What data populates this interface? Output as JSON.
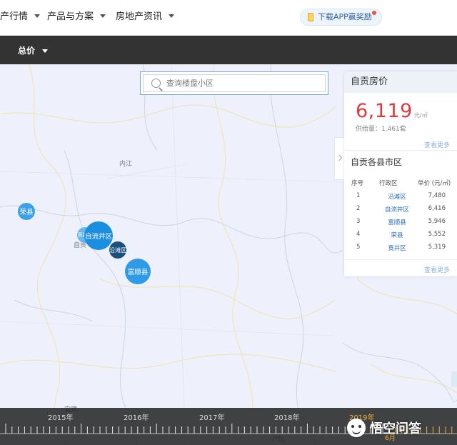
{
  "nav": {
    "items": [
      "产行情",
      "产品与方案",
      "房地产资讯"
    ],
    "app_button": "下载APP赢奖励"
  },
  "filter": {
    "total_price": "总价"
  },
  "search": {
    "placeholder": "查询楼盘小区"
  },
  "map": {
    "places": [
      "内江",
      "自贡",
      "泸州",
      "宜宾"
    ],
    "bubbles": [
      {
        "label": "荣县",
        "color": "#3aa0e8"
      },
      {
        "label": "自流井区",
        "color": "#1c8ee0"
      },
      {
        "label": "贡井区",
        "color": "#4fb0ee"
      },
      {
        "label": "沿滩区",
        "color": "#1a4f7e"
      },
      {
        "label": "富顺县",
        "color": "#2f9ae6"
      }
    ]
  },
  "panel": {
    "title": "自贡房价",
    "price": "6,119",
    "unit": "元/㎡",
    "supply": "供给量：1,461套",
    "more": "查看更多",
    "districts_title": "自贡各县市区",
    "headers": {
      "index": "序号",
      "district": "行政区",
      "price": "单价 (元/㎡)"
    },
    "rows": [
      {
        "index": "1",
        "district": "沿滩区",
        "price": "7,480"
      },
      {
        "index": "2",
        "district": "自流井区",
        "price": "6,416"
      },
      {
        "index": "3",
        "district": "富顺县",
        "price": "5,946"
      },
      {
        "index": "4",
        "district": "荣县",
        "price": "5,552"
      },
      {
        "index": "5",
        "district": "贡井区",
        "price": "5,319"
      }
    ],
    "more2": "查看更多"
  },
  "timeline": {
    "years": [
      "2015年",
      "2016年",
      "2017年",
      "2018年",
      "2019年"
    ],
    "active_year": "2019年",
    "month": "6月"
  },
  "watermark": {
    "text": "悟空问答"
  },
  "colors": {
    "accent_red": "#e4393c",
    "link_blue": "#2a6fb9",
    "timeline_active": "#f0b23a"
  }
}
